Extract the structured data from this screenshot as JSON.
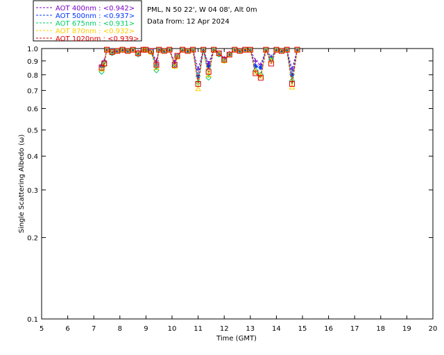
{
  "chart_data": {
    "type": "line",
    "xlabel": "Time (GMT)",
    "ylabel": "Single Scattering Albedo (ω)",
    "xlim": [
      5,
      20
    ],
    "ylim": [
      0.1,
      1.0
    ],
    "yscale": "log",
    "xticks": [
      "5",
      "6",
      "7",
      "8",
      "9",
      "10",
      "11",
      "12",
      "13",
      "14",
      "15",
      "16",
      "17",
      "18",
      "19",
      "20"
    ],
    "yticks": [
      {
        "v": 1.0,
        "label": "1.0"
      },
      {
        "v": 0.9,
        "label": "0.9"
      },
      {
        "v": 0.8,
        "label": "0.8"
      },
      {
        "v": 0.7,
        "label": "0.7"
      },
      {
        "v": 0.6,
        "label": "0.6"
      },
      {
        "v": 0.5,
        "label": "0.5"
      },
      {
        "v": 0.4,
        "label": "0.4"
      },
      {
        "v": 0.3,
        "label": "0.3"
      },
      {
        "v": 0.2,
        "label": "0.2"
      },
      {
        "v": 0.1,
        "label": "0.1"
      }
    ],
    "info_lines": [
      "PML, N 50 22', W 04 08', Alt 0m",
      "Data from: 12 Apr 2024"
    ],
    "legend_position": "top-left",
    "x": [
      7.3,
      7.4,
      7.5,
      7.7,
      7.9,
      8.1,
      8.3,
      8.5,
      8.7,
      8.9,
      9.0,
      9.2,
      9.4,
      9.5,
      9.7,
      9.9,
      10.1,
      10.2,
      10.4,
      10.6,
      10.8,
      11.0,
      11.2,
      11.4,
      11.6,
      11.8,
      12.0,
      12.2,
      12.4,
      12.6,
      12.8,
      13.0,
      13.2,
      13.4,
      13.6,
      13.8,
      14.0,
      14.2,
      14.4,
      14.6,
      14.8
    ],
    "series": [
      {
        "name": "AOT  400nm : <0.942>",
        "color": "#7b00c8",
        "marker": "plus",
        "values": [
          0.87,
          0.9,
          0.99,
          0.97,
          0.98,
          0.99,
          0.98,
          0.99,
          0.97,
          0.99,
          0.99,
          0.98,
          0.9,
          0.99,
          0.98,
          0.99,
          0.89,
          0.94,
          0.99,
          0.98,
          0.99,
          0.84,
          0.99,
          0.88,
          0.99,
          0.96,
          0.92,
          0.96,
          0.99,
          0.98,
          0.99,
          0.99,
          0.9,
          0.87,
          0.99,
          0.93,
          0.99,
          0.98,
          0.99,
          0.84,
          0.99
        ]
      },
      {
        "name": "AOT  500nm : <0.937>",
        "color": "#0033ff",
        "marker": "asterisk",
        "values": [
          0.86,
          0.89,
          0.99,
          0.97,
          0.98,
          0.99,
          0.98,
          0.99,
          0.96,
          0.99,
          0.99,
          0.98,
          0.87,
          0.99,
          0.98,
          0.99,
          0.87,
          0.94,
          0.99,
          0.98,
          0.99,
          0.79,
          0.99,
          0.86,
          0.99,
          0.96,
          0.91,
          0.95,
          0.99,
          0.98,
          0.99,
          0.99,
          0.86,
          0.85,
          0.99,
          0.92,
          0.99,
          0.98,
          0.99,
          0.8,
          0.99
        ]
      },
      {
        "name": "AOT  675nm : <0.931>",
        "color": "#00cc66",
        "marker": "diamond",
        "values": [
          0.82,
          0.87,
          0.99,
          0.96,
          0.98,
          0.99,
          0.98,
          0.99,
          0.95,
          0.99,
          0.99,
          0.97,
          0.83,
          0.99,
          0.98,
          0.99,
          0.86,
          0.93,
          0.99,
          0.98,
          0.99,
          0.75,
          0.99,
          0.78,
          0.99,
          0.95,
          0.9,
          0.95,
          0.99,
          0.98,
          0.99,
          0.99,
          0.83,
          0.8,
          0.99,
          0.91,
          0.99,
          0.98,
          0.99,
          0.76,
          0.99
        ]
      },
      {
        "name": "AOT  870nm : <0.932>",
        "color": "#ffcc00",
        "marker": "triangle",
        "values": [
          0.84,
          0.88,
          0.99,
          0.97,
          0.98,
          0.99,
          0.98,
          0.99,
          0.96,
          0.99,
          0.99,
          0.97,
          0.85,
          0.99,
          0.98,
          0.99,
          0.86,
          0.93,
          0.99,
          0.98,
          0.99,
          0.71,
          0.99,
          0.8,
          0.99,
          0.96,
          0.9,
          0.95,
          0.99,
          0.98,
          0.99,
          0.99,
          0.82,
          0.79,
          0.99,
          0.9,
          0.99,
          0.98,
          0.99,
          0.72,
          0.99
        ]
      },
      {
        "name": "AOT 1020nm : <0.939>",
        "color": "#dd0000",
        "marker": "square",
        "values": [
          0.85,
          0.88,
          0.99,
          0.97,
          0.98,
          0.99,
          0.98,
          0.99,
          0.96,
          0.99,
          0.99,
          0.98,
          0.87,
          0.99,
          0.98,
          0.99,
          0.87,
          0.94,
          0.99,
          0.98,
          0.99,
          0.74,
          0.99,
          0.82,
          0.99,
          0.96,
          0.91,
          0.95,
          0.99,
          0.98,
          0.99,
          0.99,
          0.81,
          0.78,
          0.99,
          0.88,
          0.99,
          0.98,
          0.99,
          0.74,
          0.99
        ]
      }
    ]
  }
}
